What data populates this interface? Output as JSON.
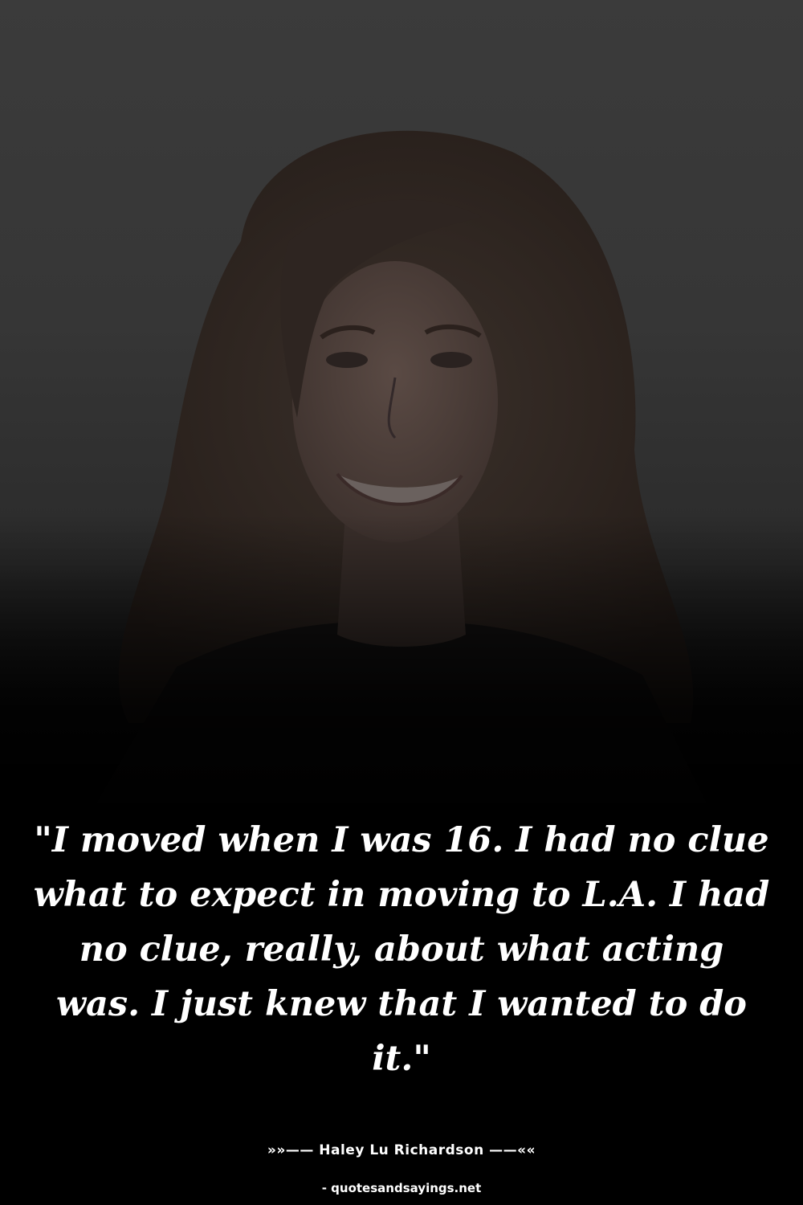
{
  "quote": {
    "text": "\"I moved when I was 16. I had no clue what to expect in moving to L.A. I had no clue, really, about what acting was. I just knew that I wanted to do it.\""
  },
  "attribution": {
    "author_line": "»»—— Haley Lu Richardson ——««"
  },
  "watermark": {
    "site": "- quotesandsayings.net"
  },
  "colors": {
    "background": "#000000",
    "photo_overlay": "#363636",
    "text": "#ffffff"
  }
}
